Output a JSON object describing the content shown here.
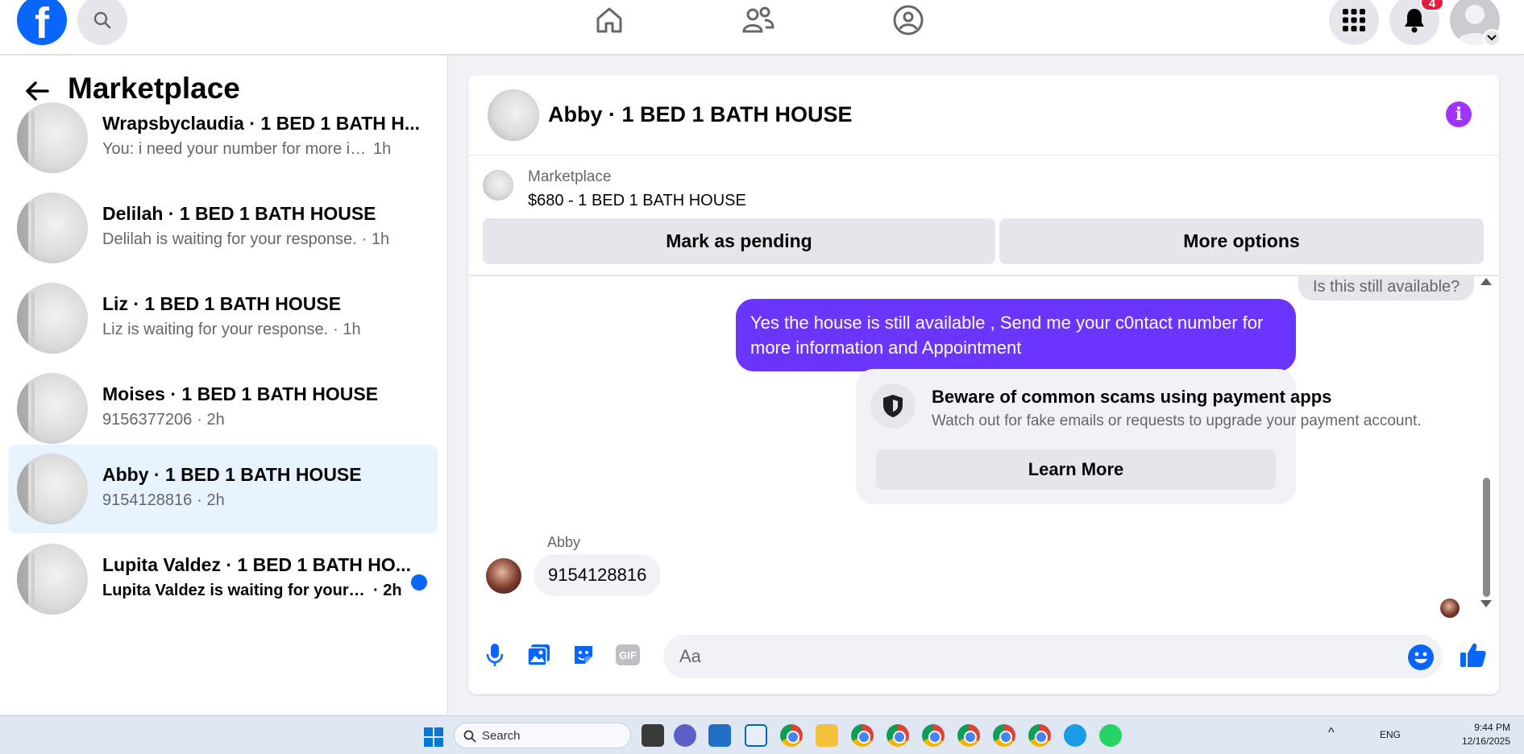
{
  "topbar": {
    "logo": "f",
    "notifications_count": "4",
    "icons": [
      "search-icon",
      "home-icon",
      "friends-icon",
      "groups-icon",
      "apps-grid-icon",
      "bell-icon",
      "chevron-down-icon"
    ]
  },
  "sidebar": {
    "title": "Marketplace",
    "conversations": [
      {
        "name": "Wrapsbyclaudia · 1 BED 1 BATH H...",
        "preview": "You: i need your number for more inf...",
        "time": "1h",
        "active": false,
        "unread": false
      },
      {
        "name": "Delilah · 1 BED 1 BATH HOUSE",
        "preview": "Delilah is waiting for your response.",
        "time": "· 1h",
        "active": false,
        "unread": false
      },
      {
        "name": "Liz · 1 BED 1 BATH HOUSE",
        "preview": "Liz is waiting for your response.",
        "time": "· 1h",
        "active": false,
        "unread": false
      },
      {
        "name": "Moises · 1 BED 1 BATH HOUSE",
        "preview": "9156377206",
        "time": "· 2h",
        "active": false,
        "unread": false
      },
      {
        "name": "Abby · 1 BED 1 BATH HOUSE",
        "preview": "9154128816",
        "time": "· 2h",
        "active": true,
        "unread": false
      },
      {
        "name": "Lupita Valdez · 1 BED 1 BATH HO...",
        "preview": "Lupita Valdez is waiting for your re...",
        "time": "· 2h",
        "active": false,
        "unread": true
      }
    ]
  },
  "chat": {
    "title": "Abby · 1 BED 1 BATH HOUSE",
    "listing": {
      "source": "Marketplace",
      "price_title": "$680 - 1 BED 1 BATH HOUSE",
      "pending_label": "Mark as pending",
      "more_label": "More options"
    },
    "messages": {
      "previous": "Is this still available?",
      "outgoing": "Yes the house is still available , Send me your c0ntact number for more information and Appointment",
      "scam_title": "Beware of common scams using payment apps",
      "scam_desc": "Watch out for fake emails or requests to upgrade your payment account.",
      "learn_more": "Learn More",
      "sender": "Abby",
      "incoming": "9154128816"
    },
    "composer": {
      "placeholder": "Aa",
      "gif_label": "GIF"
    },
    "colors": {
      "accent": "#0866ff",
      "outgoing_bubble": "#6a35ff",
      "info_icon": "#a033ff"
    }
  },
  "taskbar": {
    "search_label": "Search",
    "language": "ENG",
    "time": "9:44 PM",
    "date": "12/16/2025"
  }
}
